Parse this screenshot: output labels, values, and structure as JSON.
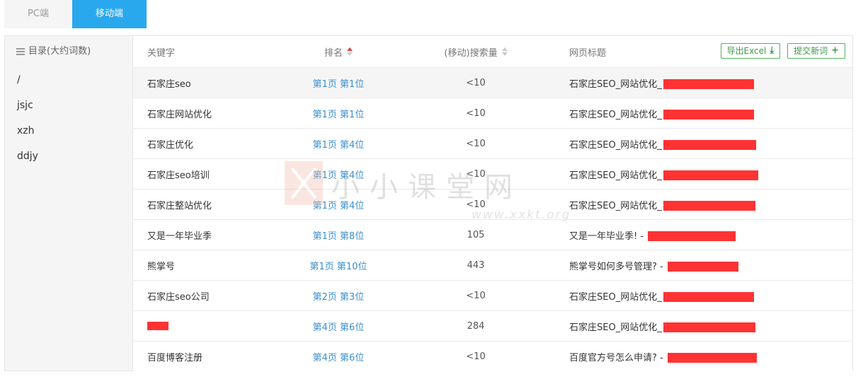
{
  "tabs": [
    {
      "label": "PC端",
      "active": false
    },
    {
      "label": "移动端",
      "active": true
    }
  ],
  "sidebar": {
    "title": "目录(大约词数)",
    "items": [
      "/",
      "jsjc",
      "xzh",
      "ddjy"
    ]
  },
  "table": {
    "headers": {
      "keyword": "关键字",
      "rank": "排名",
      "volume": "(移动)搜索量",
      "page_title": "网页标题"
    },
    "buttons": {
      "export": "导出Excel",
      "add": "提交新词"
    },
    "rows": [
      {
        "keyword": "石家庄seo",
        "rank": "第1页 第1位",
        "volume": "<10",
        "title": "石家庄SEO_网站优化_"
      },
      {
        "keyword": "石家庄网站优化",
        "rank": "第1页 第1位",
        "volume": "<10",
        "title": "石家庄SEO_网站优化_"
      },
      {
        "keyword": "石家庄优化",
        "rank": "第1页 第4位",
        "volume": "<10",
        "title": "石家庄SEO_网站优化_"
      },
      {
        "keyword": "石家庄seo培训",
        "rank": "第1页 第4位",
        "volume": "<10",
        "title": "石家庄SEO_网站优化_"
      },
      {
        "keyword": "石家庄整站优化",
        "rank": "第1页 第4位",
        "volume": "<10",
        "title": "石家庄SEO_网站优化_"
      },
      {
        "keyword": "又是一年毕业季",
        "rank": "第1页 第8位",
        "volume": "105",
        "title": "又是一年毕业季! - "
      },
      {
        "keyword": "熊掌号",
        "rank": "第1页 第10位",
        "volume": "443",
        "title": "熊掌号如何多号管理? - "
      },
      {
        "keyword": "石家庄seo公司",
        "rank": "第2页 第3位",
        "volume": "<10",
        "title": "石家庄SEO_网站优化_"
      },
      {
        "keyword": "",
        "rank": "第4页 第6位",
        "volume": "284",
        "title": "石家庄SEO_网站优化_"
      },
      {
        "keyword": "百度博客注册",
        "rank": "第4页 第6位",
        "volume": "<10",
        "title": "百度官方号怎么申请? - "
      }
    ]
  },
  "watermark": {
    "text": "小小课堂网",
    "url": "www.xxkt.org"
  },
  "colors": {
    "accent": "#2aa8ee",
    "link": "#3a8fd0",
    "button_green": "#52b25f",
    "redaction": "#ff3333",
    "sort_active": "#e84040"
  },
  "icons": {
    "sidebar_title": "list-icon",
    "export": "download-icon",
    "add": "plus-icon"
  }
}
